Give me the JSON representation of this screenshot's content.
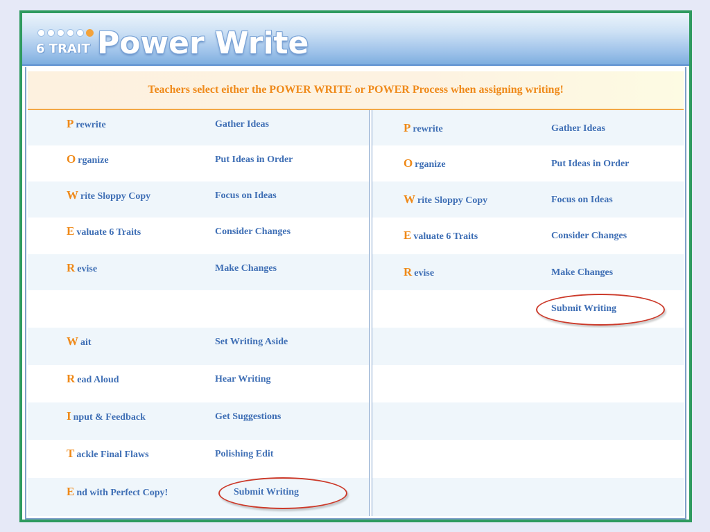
{
  "logo": {
    "brand": "6 TRAIT",
    "title": "Power Write"
  },
  "notice": "Teachers select either the POWER WRITE or POWER Process when assigning writing!",
  "left_column": [
    {
      "initial": "P",
      "rest": "rewrite",
      "description": "Gather Ideas"
    },
    {
      "initial": "O",
      "rest": "rganize",
      "description": "Put Ideas in Order"
    },
    {
      "initial": "W",
      "rest": "rite Sloppy Copy",
      "description": "Focus on Ideas"
    },
    {
      "initial": "E",
      "rest": "valuate 6 Traits",
      "description": "Consider Changes"
    },
    {
      "initial": "R",
      "rest": "evise",
      "description": "Make Changes"
    },
    {
      "initial": "",
      "rest": "",
      "description": ""
    },
    {
      "initial": "W",
      "rest": "ait",
      "description": "Set Writing Aside"
    },
    {
      "initial": "R",
      "rest": "ead Aloud",
      "description": "Hear Writing"
    },
    {
      "initial": "I",
      "rest": "nput & Feedback",
      "description": "Get Suggestions"
    },
    {
      "initial": "T",
      "rest": "ackle Final Flaws",
      "description": "Polishing Edit"
    },
    {
      "initial": "E",
      "rest": "nd with Perfect Copy!",
      "description": "Submit Writing",
      "circled": true
    }
  ],
  "right_column": [
    {
      "initial": "P",
      "rest": "rewrite",
      "description": "Gather Ideas"
    },
    {
      "initial": "O",
      "rest": "rganize",
      "description": "Put Ideas in Order"
    },
    {
      "initial": "W",
      "rest": "rite Sloppy Copy",
      "description": "Focus on Ideas"
    },
    {
      "initial": "E",
      "rest": "valuate 6 Traits",
      "description": "Consider Changes"
    },
    {
      "initial": "R",
      "rest": "evise",
      "description": "Make Changes"
    },
    {
      "initial": "",
      "rest": "",
      "description": "Submit Writing",
      "circled": true
    },
    {
      "initial": "",
      "rest": "",
      "description": ""
    },
    {
      "initial": "",
      "rest": "",
      "description": ""
    },
    {
      "initial": "",
      "rest": "",
      "description": ""
    },
    {
      "initial": "",
      "rest": "",
      "description": ""
    },
    {
      "initial": "",
      "rest": "",
      "description": ""
    }
  ],
  "colors": {
    "accent_orange": "#ef8a1a",
    "text_blue": "#3f6fb5",
    "frame_green": "#2e9a5f",
    "circle_red": "#cc3a2a"
  }
}
